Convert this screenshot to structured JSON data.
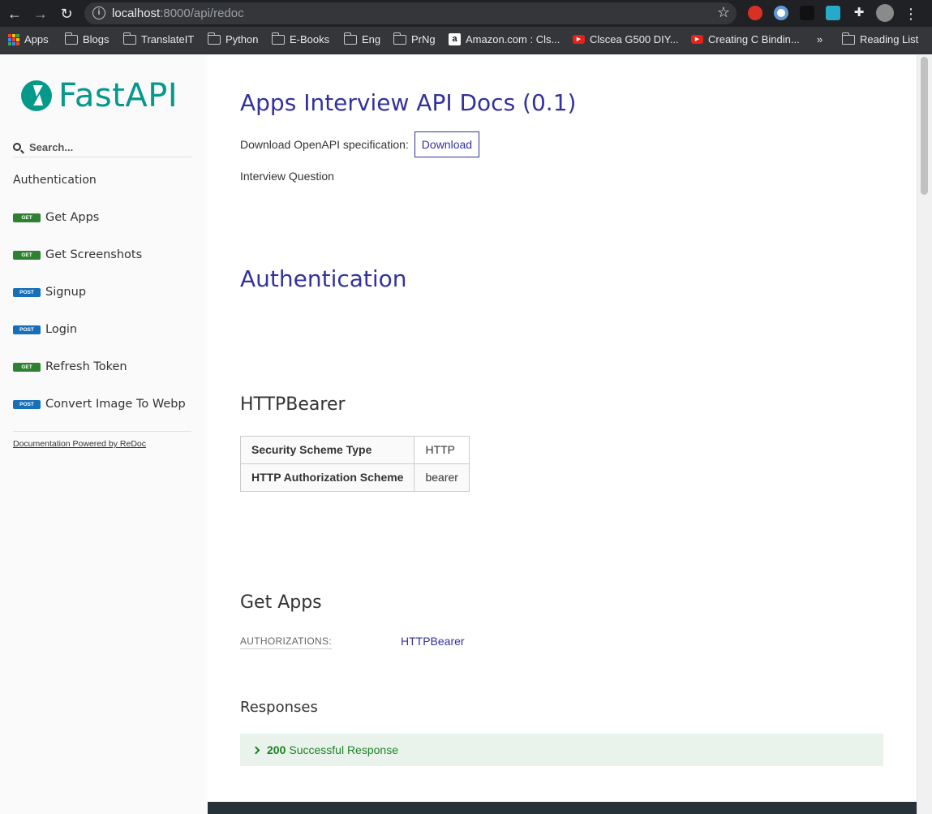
{
  "browser": {
    "url_host": "localhost",
    "url_rest": ":8000/api/redoc",
    "bookmarks": [
      {
        "label": "Apps",
        "icon": "apps-grid-icon"
      },
      {
        "label": "Blogs",
        "icon": "folder-icon"
      },
      {
        "label": "TranslateIT",
        "icon": "folder-icon"
      },
      {
        "label": "Python",
        "icon": "folder-icon"
      },
      {
        "label": "E-Books",
        "icon": "folder-icon"
      },
      {
        "label": "Eng",
        "icon": "folder-icon"
      },
      {
        "label": "PrNg",
        "icon": "folder-icon"
      },
      {
        "label": "Amazon.com : Cls...",
        "icon": "amazon-icon"
      },
      {
        "label": "Clscea G500 DIY...",
        "icon": "youtube-icon"
      },
      {
        "label": "Creating C Bindin...",
        "icon": "youtube-icon"
      }
    ],
    "overflow": "»",
    "reading_list": "Reading List"
  },
  "sidebar": {
    "logo_text": "FastAPI",
    "search_placeholder": "Search...",
    "auth_item": "Authentication",
    "items": [
      {
        "method": "GET",
        "label": "Get Apps"
      },
      {
        "method": "GET",
        "label": "Get Screenshots"
      },
      {
        "method": "POST",
        "label": "Signup"
      },
      {
        "method": "POST",
        "label": "Login"
      },
      {
        "method": "GET",
        "label": "Refresh Token"
      },
      {
        "method": "POST",
        "label": "Convert Image To Webp"
      }
    ],
    "powered_by": "Documentation Powered by ReDoc"
  },
  "main": {
    "title": "Apps Interview API Docs (0.1)",
    "download_text": "Download OpenAPI specification:",
    "download_button": "Download",
    "description": "Interview Question",
    "auth_heading": "Authentication",
    "scheme_heading": "HTTPBearer",
    "scheme_table": [
      {
        "key": "Security Scheme Type",
        "value": "HTTP"
      },
      {
        "key": "HTTP Authorization Scheme",
        "value": "bearer"
      }
    ],
    "endpoint_heading": "Get Apps",
    "authorizations_label": "AUTHORIZATIONS:",
    "authorizations_value": "HTTPBearer",
    "responses_heading": "Responses",
    "response_code": "200",
    "response_text": "Successful Response"
  },
  "colors": {
    "accent": "#32329f",
    "fastapi_teal": "#05998b",
    "get_badge": "#2f8132",
    "post_badge": "#186fb5",
    "response_bg": "#e9f3ec"
  }
}
